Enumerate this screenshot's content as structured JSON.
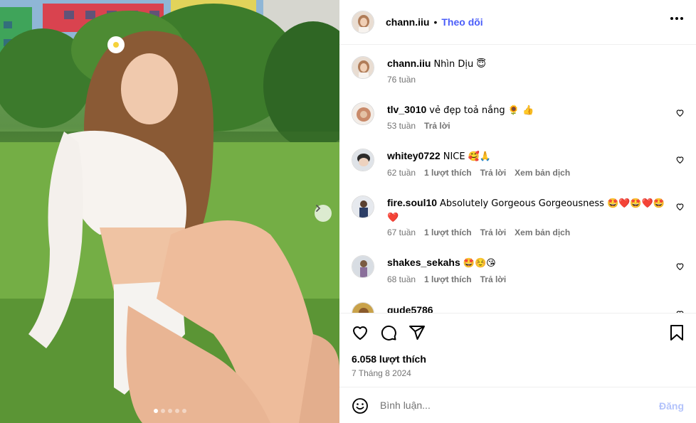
{
  "post": {
    "author": "chann.iiu",
    "separator": "•",
    "follow_label": "Theo dõi",
    "more_icon": "more-horizontal-icon",
    "caption": {
      "user": "chann.iiu",
      "text": "Nhìn Dịu 😇",
      "time": "76 tuần"
    },
    "likes": "6.058 lượt thích",
    "date": "7 Tháng 8 2024",
    "image_dots": 5,
    "active_dot": 0
  },
  "comments": [
    {
      "user": "tlv_3010",
      "text": "vẻ đẹp toả nắng 🌻 👍",
      "time": "53 tuần",
      "likes": "",
      "reply": "Trả lời",
      "translate": ""
    },
    {
      "user": "whitey0722",
      "text": "NICE 🥰🙏",
      "time": "62 tuần",
      "likes": "1 lượt thích",
      "reply": "Trả lời",
      "translate": "Xem bản dịch"
    },
    {
      "user": "fire.soul10",
      "text": "Absolutely Gorgeous Gorgeousness 🤩❤️🤩❤️🤩❤️",
      "time": "67 tuần",
      "likes": "1 lượt thích",
      "reply": "Trả lời",
      "translate": "Xem bản dịch"
    },
    {
      "user": "shakes_sekahs",
      "text": "🤩☺️😘",
      "time": "68 tuần",
      "likes": "1 lượt thích",
      "reply": "Trả lời",
      "translate": ""
    },
    {
      "user": "gude5786",
      "text": "",
      "time": "",
      "likes": "",
      "reply": "",
      "translate": ""
    }
  ],
  "composer": {
    "placeholder": "Bình luận...",
    "post_label": "Đăng",
    "post_color": "#b3c3fb"
  },
  "colors": {
    "accent": "#4a5df9",
    "muted": "#737373",
    "divider": "#efefef"
  }
}
